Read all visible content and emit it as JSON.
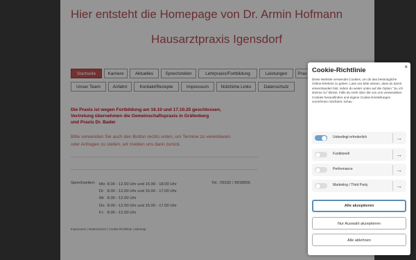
{
  "header": {
    "title": "Hier entsteht die Homepage von Dr. Armin Hofmann",
    "subtitle": "Hausarztpraxis Igensdorf"
  },
  "nav": {
    "row1": [
      "Startseite",
      "Karriere",
      "Aktuelles",
      "Sprechzeiten",
      "Lehrpraxis/Fortbildung",
      "Leistungen",
      "Prax"
    ],
    "row2": [
      "Unser Team",
      "Anfahrt",
      "Kontakt/Rezepte",
      "Impressum",
      "Nützliche Links",
      "Datenschutz"
    ],
    "active": "Startseite"
  },
  "notice": {
    "line1": "Die Praxis ist wegen  Fortbildung am 16.10 und 17.10.25 geschlossen,",
    "line2": "Vertretung übernehmen die Gemeinschaftspraxis in Gräfenberg",
    "line3": "und Praxis Dr. Bader"
  },
  "info": {
    "line1": "Bitte verwenden Sie auch den Button rechts unten, um Termine zu vereinbaren",
    "line2": "oder Anfragen zu stellen, wir melden uns dann zurück."
  },
  "hours": {
    "label": "Sprechzeiten:",
    "rows": [
      {
        "day": "Mo:",
        "morning": "8.00 - 12.00 Uhr",
        "afternoon": "und 15.00 - 18.00 Uhr"
      },
      {
        "day": "Di:",
        "morning": "8.00 - 12.00 Uhr",
        "afternoon": "und 15.00 - 17.00 Uhr"
      },
      {
        "day": "Mi:",
        "morning": "8.00 - 12.00 Uhr",
        "afternoon": ""
      },
      {
        "day": "Do:",
        "morning": "8.00 - 12.00 Uhr",
        "afternoon": "und 15.00 - 17.00 Uhr"
      },
      {
        "day": "Fr:",
        "morning": "8.00 - 12.00 Uhr",
        "afternoon": ""
      }
    ],
    "tel": "Tel.: 09192 / 9918959"
  },
  "footer": "Impressum | Datenschutz | Cookie-Richtlinie | Sitemap",
  "cookie": {
    "title": "Cookie-Richtlinie",
    "close": "×",
    "text": "Diese Website verwendet Cookies, um dir das bestmögliche Online-Erlebnis zu geben. Lass uns bitte wissen, dass du damit einverstanden bist, indem du weiter unten auf die Option \"Ja, ich stimme zu\" klickst. Falls du mehr über die von uns verwendeten Cookies herausfinden und eigene Cookie-Einstellungen vornehmen möchtest, schau",
    "link_impressum": "Impressum",
    "link_datenschutz": "Datenschutzerklärung",
    "categories": [
      {
        "label": "Unbedingt erforderlich",
        "on": true
      },
      {
        "label": "Funktionell",
        "on": false
      },
      {
        "label": "Performance",
        "on": false
      },
      {
        "label": "Marketing / Third Party",
        "on": false
      }
    ],
    "arrow": "→",
    "accept_all": "Alle akzeptieren",
    "accept_selection": "Nur Auswahl akzeptieren",
    "reject_all": "Alle ablehnen",
    "accent": "#5a8fb5"
  },
  "colors": {
    "brand": "#a7494f",
    "notice": "#b01020",
    "toggle_on": "#6d9fcf"
  }
}
